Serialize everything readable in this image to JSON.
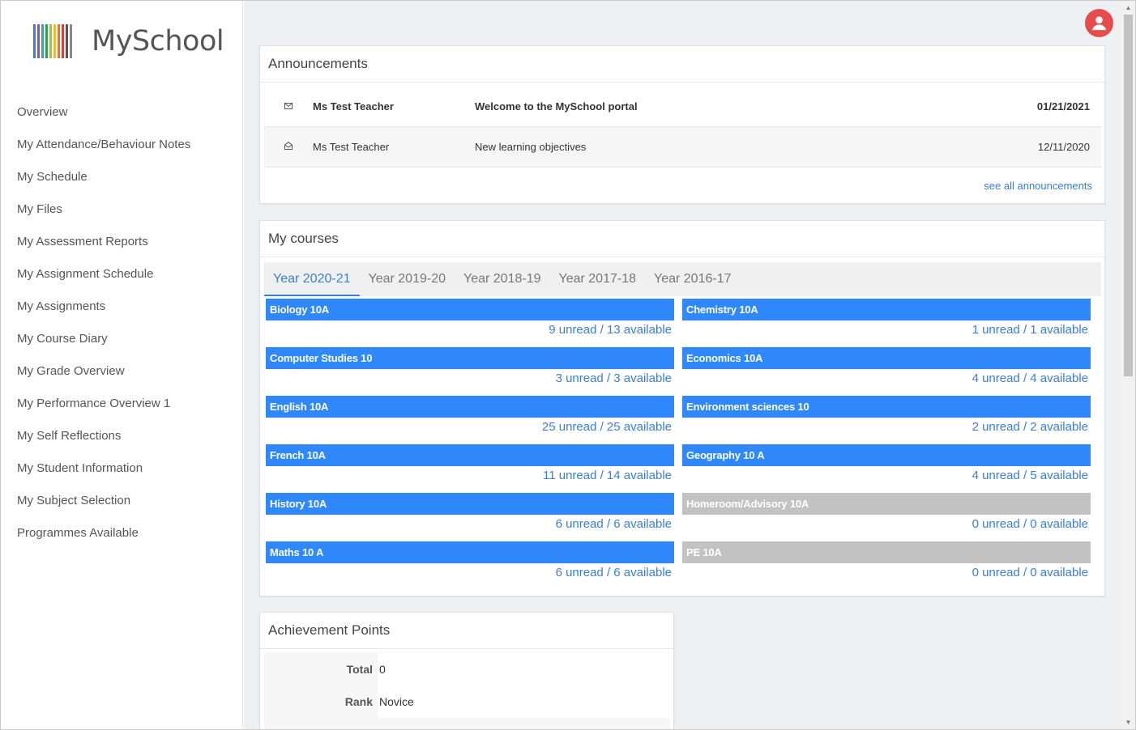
{
  "app": {
    "logo_text": "MySchool",
    "logo_colors": [
      "#3a7fd5",
      "#7b5ea7",
      "#2aa8b8",
      "#2e9e4f",
      "#a4c639",
      "#f2b632",
      "#e8762c",
      "#d9413d",
      "#555555",
      "#888888"
    ]
  },
  "sidebar": {
    "items": [
      {
        "label": "Overview"
      },
      {
        "label": "My Attendance/Behaviour Notes"
      },
      {
        "label": "My Schedule"
      },
      {
        "label": "My Files"
      },
      {
        "label": "My Assessment Reports"
      },
      {
        "label": "My Assignment Schedule"
      },
      {
        "label": "My Assignments"
      },
      {
        "label": "My Course Diary"
      },
      {
        "label": "My Grade Overview"
      },
      {
        "label": "My Performance Overview 1"
      },
      {
        "label": "My Self Reflections"
      },
      {
        "label": "My Student Information"
      },
      {
        "label": "My Subject Selection"
      },
      {
        "label": "Programmes Available"
      }
    ]
  },
  "announcements": {
    "title": "Announcements",
    "rows": [
      {
        "icon": "envelope-closed-icon",
        "from": "Ms Test Teacher",
        "subject": "Welcome to the MySchool portal",
        "date": "01/21/2021"
      },
      {
        "icon": "envelope-open-icon",
        "from": "Ms Test Teacher",
        "subject": "New learning objectives",
        "date": "12/11/2020"
      }
    ],
    "see_all": "see all announcements"
  },
  "courses": {
    "title": "My courses",
    "tabs": [
      {
        "label": "Year 2020-21",
        "active": true
      },
      {
        "label": "Year 2019-20",
        "active": false
      },
      {
        "label": "Year 2018-19",
        "active": false
      },
      {
        "label": "Year 2017-18",
        "active": false
      },
      {
        "label": "Year 2016-17",
        "active": false
      }
    ],
    "items": [
      {
        "name": "Biology 10A",
        "stats": "9 unread / 13 available",
        "active": true
      },
      {
        "name": "Chemistry 10A",
        "stats": "1 unread / 1 available",
        "active": true
      },
      {
        "name": "Computer Studies 10",
        "stats": "3 unread / 3 available",
        "active": true
      },
      {
        "name": "Economics 10A",
        "stats": "4 unread / 4 available",
        "active": true
      },
      {
        "name": "English 10A",
        "stats": "25 unread / 25 available",
        "active": true
      },
      {
        "name": "Environment sciences 10",
        "stats": "2 unread / 2 available",
        "active": true
      },
      {
        "name": "French 10A",
        "stats": "11 unread / 14 available",
        "active": true
      },
      {
        "name": "Geography 10 A",
        "stats": "4 unread / 5 available",
        "active": true
      },
      {
        "name": "History 10A",
        "stats": "6 unread / 6 available",
        "active": true
      },
      {
        "name": "Homeroom/Advisory 10A",
        "stats": "0 unread / 0 available",
        "active": false
      },
      {
        "name": "Maths 10 A",
        "stats": "6 unread / 6 available",
        "active": true
      },
      {
        "name": "PE 10A",
        "stats": "0 unread / 0 available",
        "active": false
      }
    ],
    "colors": {
      "active": "#2f89fc",
      "inactive": "#c2c2c2",
      "link": "#3a7fd5"
    }
  },
  "achievement": {
    "title": "Achievement Points",
    "rows": [
      {
        "label": "Total",
        "value": "0"
      },
      {
        "label": "Rank",
        "value": "Novice"
      }
    ]
  },
  "user": {
    "icon": "user-avatar-icon",
    "color": "#e74c4c"
  }
}
